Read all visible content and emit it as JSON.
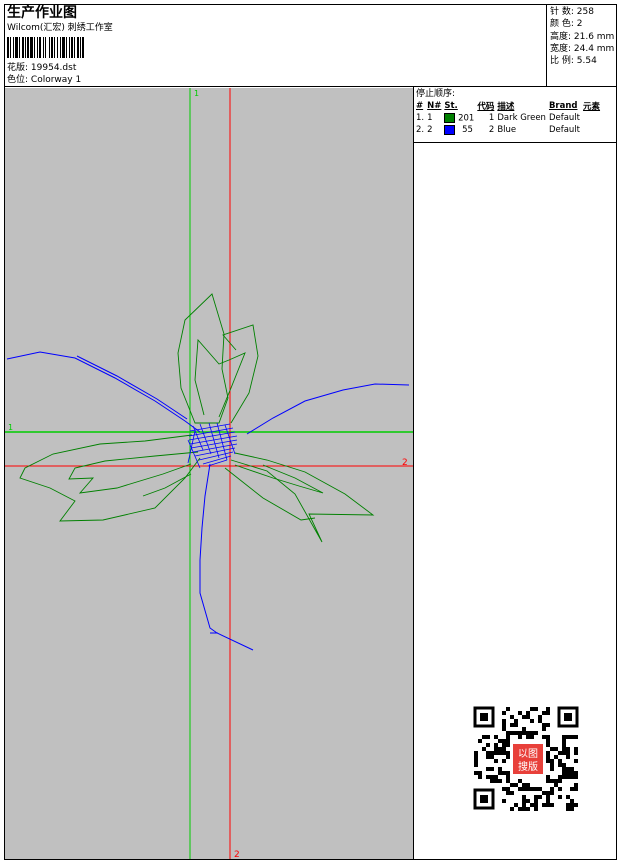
{
  "header": {
    "title": "生产作业图",
    "company": "Wilcom(汇宏) 刺绣工作室",
    "design_label": "花版:",
    "design_value": "19954.dst",
    "colorway_label": "色位:",
    "colorway_value": "Colorway 1"
  },
  "stats": {
    "stitches": "针 数: 258",
    "colors": "颜 色: 2",
    "height": "高度: 21.6 mm",
    "width": "宽度: 24.4 mm",
    "scale": "比 例: 5.54"
  },
  "stop_sequence": {
    "title": "停止顺序:",
    "columns": [
      "#",
      "N#",
      "St.",
      "代码",
      "描述",
      "Brand",
      "元素"
    ],
    "rows": [
      {
        "num": "1.",
        "needle": "1",
        "stitches": "201",
        "code": "1",
        "desc": "Dark Green",
        "brand": "Default",
        "color": "#008000"
      },
      {
        "num": "2.",
        "needle": "2",
        "stitches": "55",
        "code": "2",
        "desc": "Blue",
        "brand": "Default",
        "color": "#0000ff"
      }
    ]
  },
  "axis_labels": {
    "green_top": "1",
    "green_left": "1",
    "red_right": "2",
    "red_bottom": "2"
  },
  "colors": {
    "canvas": "#c0c0c0",
    "green": "#00cc00",
    "red": "#ff0000",
    "thread_green": "#008000",
    "thread_blue": "#0000ff"
  },
  "qr": {
    "stamp_text": "以图搜版"
  }
}
